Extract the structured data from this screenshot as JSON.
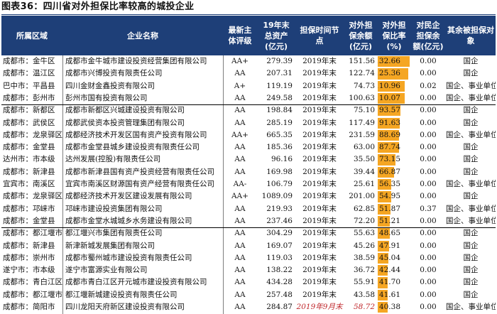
{
  "title": "图表36：四川省对外担保比率较高的城投企业",
  "headers": [
    "所属区域",
    "企业名称",
    "最新主\n体评级",
    "19年末\n总资产\n(亿元)",
    "担保时间节\n点",
    "对外担\n保余额\n(亿元)",
    "对外担\n保比率\n(%)",
    "对民企\n担保余\n额(亿元)",
    "其余被担保对\n象"
  ],
  "rows": [
    [
      "成都市：金牛区",
      "成都市金牛城市建设投资经营集团有限公司",
      "AA+",
      "279.39",
      "2019年末",
      "151.56",
      "132.66",
      "0.00",
      "国企"
    ],
    [
      "成都市：温江区",
      "成都市兴博投资有限责任公司",
      "AA",
      "207.31",
      "2019年末",
      "122.74",
      "125.36",
      "0.00",
      "国企"
    ],
    [
      "巴中市：平昌县",
      "四川金财金鑫投资有限公司",
      "A+",
      "119.19",
      "2019年末",
      "74.73",
      "110.96",
      "0.02",
      "国企、事业单位"
    ],
    [
      "成都市：彭州市",
      "彭州市国有投资有限公司",
      "AA",
      "249.58",
      "2019年末",
      "100.63",
      "110.07",
      "0.00",
      "国企、事业单位"
    ],
    [
      "成都市：新都区",
      "成都市新都区兴城建设投资有限公司",
      "AA",
      "198.84",
      "2019年末",
      "75.10",
      "93.57",
      "0.00",
      "国企"
    ],
    [
      "成都市：武侯区",
      "成都武侯资本投资管理集团有限公司",
      "AA",
      "285.19",
      "2019年末",
      "117.49",
      "91.63",
      "0.00",
      "国企"
    ],
    [
      "成都市：龙泉驿区",
      "成都经济技术开发区国有资产投资有限公司",
      "AA+",
      "665.35",
      "2019年末",
      "231.59",
      "88.69",
      "0.00",
      "国企、事业单位"
    ],
    [
      "成都市：金堂县",
      "成都市金堂县城乡建设投资有限责任公司",
      "AA",
      "185.36",
      "2019年末",
      "63.00",
      "87.74",
      "0.00",
      "国企"
    ],
    [
      "达州市：市本级",
      "达州发展(控股)有限责任公司",
      "AA",
      "96.16",
      "2019年末",
      "35.50",
      "73.15",
      "0.00",
      "国企"
    ],
    [
      "成都市：新津县",
      "成都市新津县国有资产投资经营有限责任公司",
      "AA",
      "169.98",
      "2019年末",
      "39.44",
      "66.87",
      "0.00",
      "国企"
    ],
    [
      "宜宾市：南溪区",
      "宜宾市南溪区财源国有资产经营有限责任公司",
      "AA-",
      "106.79",
      "2019年末",
      "25.61",
      "56.35",
      "0.00",
      "国企、事业单位"
    ],
    [
      "成都市：龙泉驿区",
      "成都经济技术开发区建设发展有限公司",
      "AA+",
      "1089.09",
      "2019年末",
      "201.00",
      "54.95",
      "0.00",
      "国企"
    ],
    [
      "成都市：邛崃市",
      "邛崃市建设投资集团有限公司",
      "AA",
      "219.93",
      "2019年末",
      "62.85",
      "51.87",
      "0.37",
      "国企、事业单位"
    ],
    [
      "成都市：金堂县",
      "成都市金堂水城城乡水务建设有限公司",
      "AA",
      "237.46",
      "2019年末",
      "72.20",
      "51.21",
      "0.00",
      "国企、事业单位"
    ],
    [
      "成都市：都江堰市",
      "都江堰兴市集团有限责任公司",
      "AA",
      "304.29",
      "2019年末",
      "55.63",
      "48.65",
      "0.00",
      "国企"
    ],
    [
      "成都市：新津县",
      "新津新城发展集团有限公司",
      "AA",
      "169.07",
      "2019年末",
      "45.26",
      "47.91",
      "0.00",
      "国企"
    ],
    [
      "成都市：崇州市",
      "成都市蜀州城市建设投资有限责任公司",
      "AA",
      "119.03",
      "2019年末",
      "38.59",
      "45.04",
      "0.00",
      "国企"
    ],
    [
      "遂宁市：市本级",
      "遂宁市富源实业有限公司",
      "AA",
      "138.22",
      "2019年末",
      "36.72",
      "42.44",
      "0.00",
      "国企"
    ],
    [
      "成都市：青白江区",
      "成都市青白江区开元城市建设投资有限公司",
      "AA",
      "434.28",
      "2019年末",
      "55.91",
      "41.70",
      "0.00",
      "国企"
    ],
    [
      "成都市：都江堰市",
      "都江堰新城建设投资有限责任公司",
      "AA",
      "257.48",
      "2019年末",
      "43.58",
      "41.61",
      "0.00",
      "国企"
    ],
    [
      "成都市：简阳市",
      "四川龙阳天府新区建设投资有限公司",
      "AA",
      "284.87",
      "2019年9月末",
      "58.72",
      "40.38",
      "0.00",
      "国企、事业单位"
    ]
  ],
  "colors": {
    "header_bg": "#1e3f78",
    "header_text": "#ffffff",
    "bar": "#f5a623",
    "highlight_red": "#c0282d"
  },
  "bar_max_ratio": 135,
  "group_ends": [
    3,
    13
  ],
  "highlight_row": 20
}
